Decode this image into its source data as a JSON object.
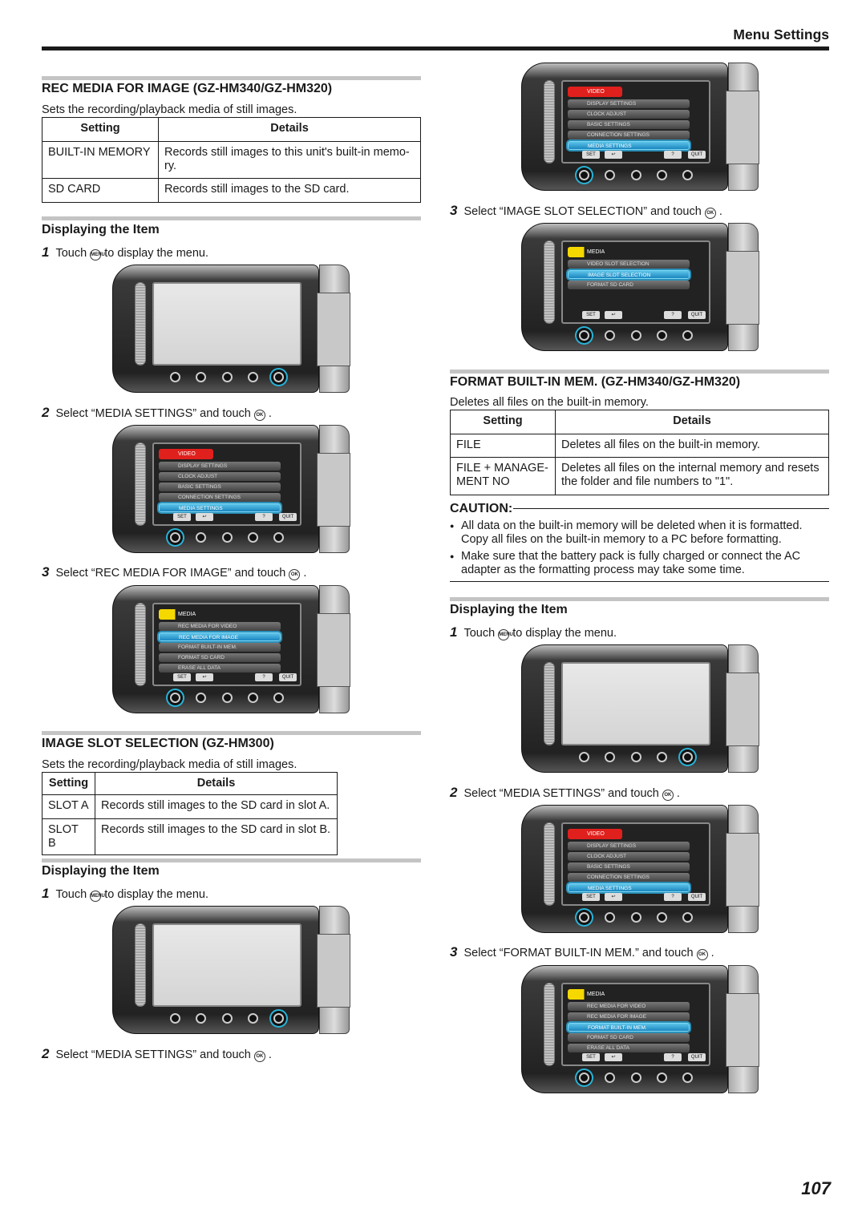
{
  "header": {
    "title": "Menu Settings"
  },
  "page_number": "107",
  "rec_media": {
    "title": "REC MEDIA FOR IMAGE (GZ-HM340/GZ-HM320)",
    "desc": "Sets the recording/playback media of still images.",
    "columns": [
      "Setting",
      "Details"
    ],
    "rows": [
      [
        "BUILT-IN MEMORY",
        "Records still images to this unit's built-in memo-ry."
      ],
      [
        "SD CARD",
        "Records still images to the SD card."
      ]
    ]
  },
  "display_a": {
    "title": "Displaying the Item",
    "steps": [
      {
        "num": "1",
        "before": "Touch",
        "icon": "MENU",
        "after": "to display the menu."
      },
      {
        "num": "2",
        "before": "Select “MEDIA SETTINGS” and touch",
        "icon": "OK",
        "after": "."
      },
      {
        "num": "3",
        "before": "Select “REC MEDIA FOR IMAGE” and touch",
        "icon": "OK",
        "after": "."
      }
    ]
  },
  "image_slot": {
    "title": "IMAGE SLOT SELECTION (GZ-HM300)",
    "desc": "Sets the recording/playback media of still images.",
    "columns": [
      "Setting",
      "Details"
    ],
    "rows": [
      [
        "SLOT A",
        "Records still images to the SD card in slot A."
      ],
      [
        "SLOT B",
        "Records still images to the SD card in slot B."
      ]
    ]
  },
  "display_b": {
    "title": "Displaying the Item",
    "steps": [
      {
        "num": "1",
        "before": "Touch",
        "icon": "MENU",
        "after": "to display the menu."
      },
      {
        "num": "2",
        "before": "Select “MEDIA SETTINGS” and touch",
        "icon": "OK",
        "after": "."
      },
      {
        "num": "3",
        "before": "Select “IMAGE SLOT SELECTION” and touch",
        "icon": "OK",
        "after": "."
      }
    ]
  },
  "format": {
    "title": "FORMAT BUILT-IN MEM. (GZ-HM340/GZ-HM320)",
    "desc": "Deletes all files on the built-in memory.",
    "columns": [
      "Setting",
      "Details"
    ],
    "rows": [
      [
        "FILE",
        "Deletes all files on the built-in memory."
      ],
      [
        "FILE + MANAGE-MENT NO",
        "Deletes all files on the internal memory and resets the folder and file numbers to \"1\"."
      ]
    ]
  },
  "caution": {
    "title": "CAUTION:",
    "items": [
      [
        "All data on the built-in memory will be deleted when it is formatted.",
        "Copy all files on the built-in memory to a PC before formatting."
      ],
      [
        "Make sure that the battery pack is fully charged or connect the AC",
        "adapter as the formatting process may take some time."
      ]
    ]
  },
  "display_c": {
    "title": "Displaying the Item",
    "steps": [
      {
        "num": "1",
        "before": "Touch",
        "icon": "MENU",
        "after": "to display the menu."
      },
      {
        "num": "2",
        "before": "Select “MEDIA SETTINGS” and touch",
        "icon": "OK",
        "after": "."
      },
      {
        "num": "3",
        "before": "Select “FORMAT BUILT-IN MEM.” and touch",
        "icon": "OK",
        "after": "."
      }
    ]
  },
  "camera_ui": {
    "buttons": [
      "SET",
      "↩",
      "?",
      "QUIT"
    ],
    "highlight_color": "#29b3d8",
    "video_tab_color": "#e0201c",
    "media_tab_color": "#f5d800"
  },
  "menus": {
    "video": {
      "tab": "VIDEO",
      "items": [
        "DISPLAY SETTINGS",
        "CLOCK ADJUST",
        "BASIC SETTINGS",
        "CONNECTION SETTINGS",
        "MEDIA SETTINGS"
      ],
      "selected": 4
    },
    "media_rec": {
      "tab": "MEDIA SETTINGS",
      "items": [
        "REC MEDIA FOR VIDEO",
        "REC MEDIA FOR IMAGE",
        "FORMAT BUILT-IN MEM.",
        "FORMAT SD CARD",
        "ERASE ALL DATA"
      ],
      "selected": 1
    },
    "media_slot": {
      "tab": "MEDIA SETTINGS",
      "items": [
        "VIDEO SLOT SELECTION",
        "IMAGE SLOT SELECTION",
        "FORMAT SD CARD"
      ],
      "selected": 1
    },
    "media_format": {
      "tab": "MEDIA SETTINGS",
      "items": [
        "REC MEDIA FOR VIDEO",
        "REC MEDIA FOR IMAGE",
        "FORMAT BUILT-IN MEM.",
        "FORMAT SD CARD",
        "ERASE ALL DATA"
      ],
      "selected": 2
    }
  }
}
